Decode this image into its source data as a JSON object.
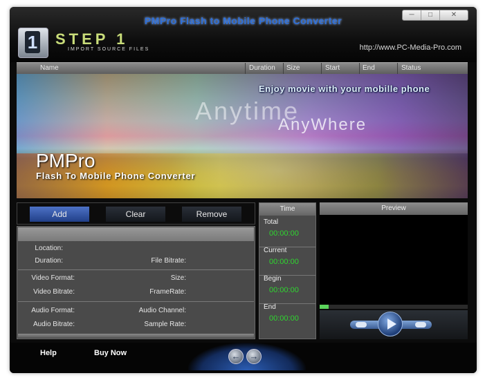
{
  "window": {
    "title": "PMPro Flash to Mobile Phone Converter",
    "controls": {
      "minimize_icon": "minimize-icon",
      "maximize_icon": "maximize-icon",
      "close_icon": "close-icon"
    }
  },
  "header": {
    "step_number": "1",
    "step_title": "STEP 1",
    "step_subtitle": "IMPORT SOURCE FILES",
    "website": "http://www.PC-Media-Pro.com"
  },
  "file_list": {
    "columns": [
      "Name",
      "Duration",
      "Size",
      "Start",
      "End",
      "Status"
    ]
  },
  "banner": {
    "tagline": "Enjoy movie with your mobille phone",
    "anytime": "Anytime",
    "anywhere": "AnyWhere",
    "brand": "PMPro",
    "product": "Flash To Mobile Phone Converter"
  },
  "toolbar": {
    "add_label": "Add",
    "clear_label": "Clear",
    "remove_label": "Remove"
  },
  "file_info": {
    "location": "Location:",
    "duration": "Duration:",
    "file_bitrate": "File Bitrate:",
    "video_format": "Video Format:",
    "size": "Size:",
    "video_bitrate": "Video Bitrate:",
    "frame_rate": "FrameRate:",
    "audio_format": "Audio Format:",
    "audio_channel": "Audio Channel:",
    "audio_bitrate": "Audio Bitrate:",
    "sample_rate": "Sample Rate:"
  },
  "time_panel": {
    "title": "Time",
    "items": [
      {
        "label": "Total",
        "value": "00:00:00"
      },
      {
        "label": "Current",
        "value": "00:00:00"
      },
      {
        "label": "Begin",
        "value": "00:00:00"
      },
      {
        "label": "End",
        "value": "00:00:00"
      }
    ]
  },
  "preview": {
    "title": "Preview",
    "progress": 0.06
  },
  "footer": {
    "help_label": "Help",
    "buy_label": "Buy Now",
    "back_icon": "arrow-left-icon",
    "next_icon": "arrow-right-icon"
  },
  "colors": {
    "accent_blue": "#2e6fd8",
    "time_green": "#2fd62f",
    "step_yellow": "#c9dd7a"
  }
}
